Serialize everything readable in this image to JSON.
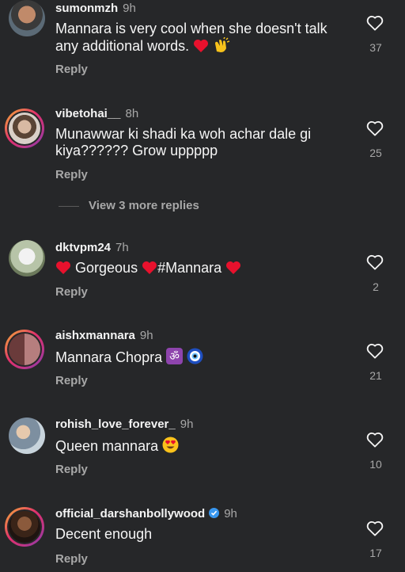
{
  "comments": [
    {
      "username": "sumonmzh",
      "time": "9h",
      "text": "Mannara is very cool when she doesn't talk any additional words.",
      "emojis": [
        "red-heart",
        "clapping-hands"
      ],
      "reply": "Reply",
      "likes": "37",
      "verified": false
    },
    {
      "username": "vibetohai__",
      "time": "8h",
      "text": "Munawwar ki shadi ka woh achar dale gi kiya?????? Grow uppppp",
      "emojis": [],
      "reply": "Reply",
      "likes": "25",
      "verified": false
    },
    {
      "username": "dktvpm24",
      "time": "7h",
      "text_parts": [
        "Gorgeous",
        "#Mannara"
      ],
      "emojis": [
        "red-heart",
        "red-heart",
        "red-heart"
      ],
      "reply": "Reply",
      "likes": "2",
      "verified": false
    },
    {
      "username": "aishxmannara",
      "time": "9h",
      "text": "Mannara Chopra",
      "emojis": [
        "om-symbol",
        "nazar-amulet"
      ],
      "reply": "Reply",
      "likes": "21",
      "verified": false
    },
    {
      "username": "rohish_love_forever_",
      "time": "9h",
      "text": "Queen mannara",
      "emojis": [
        "heart-eyes"
      ],
      "reply": "Reply",
      "likes": "10",
      "verified": false
    },
    {
      "username": "official_darshanbollywood",
      "time": "9h",
      "text": "Decent enough",
      "emojis": [],
      "reply": "Reply",
      "likes": "17",
      "verified": true
    }
  ],
  "view_more_replies": "View 3 more replies",
  "colors": {
    "background": "#262729",
    "primary_text": "#f5f5f5",
    "secondary_text": "#a8a8a8",
    "verified": "#3897f0",
    "heart_emoji": "#e8112d"
  },
  "icons": {
    "like": "heart-outline-icon",
    "verified": "verified-badge-icon"
  }
}
